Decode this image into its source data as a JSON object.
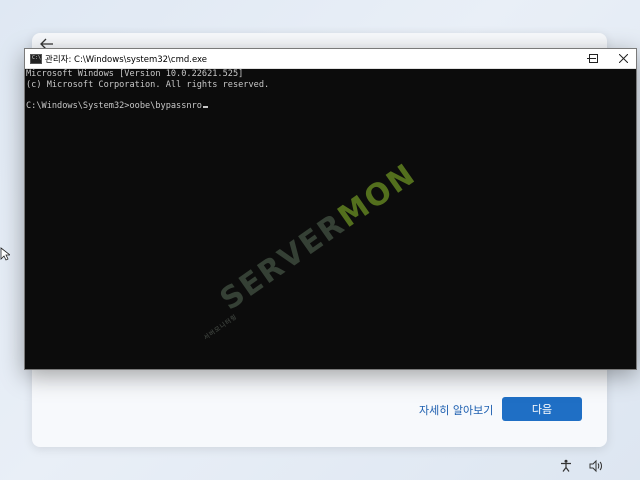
{
  "oobe": {
    "back_icon": "back-arrow-icon",
    "learn_more_label": "자세히 알아보기",
    "next_label": "다음",
    "next_color": "#1f6fc5"
  },
  "cmd": {
    "title": "관리자: C:\\Windows\\system32\\cmd.exe",
    "lines": [
      "Microsoft Windows [Version 10.0.22621.525]",
      "(c) Microsoft Corporation. All rights reserved.",
      "",
      "C:\\Windows\\System32>oobe\\bypassnro"
    ],
    "background": "#0c0c0c",
    "text_color": "#c8c8c8"
  },
  "watermark": {
    "part1": "SERVER",
    "part2": "MON",
    "small": "서버모니터링"
  },
  "taskbar": {
    "icons": [
      "accessibility-icon",
      "volume-icon"
    ]
  }
}
